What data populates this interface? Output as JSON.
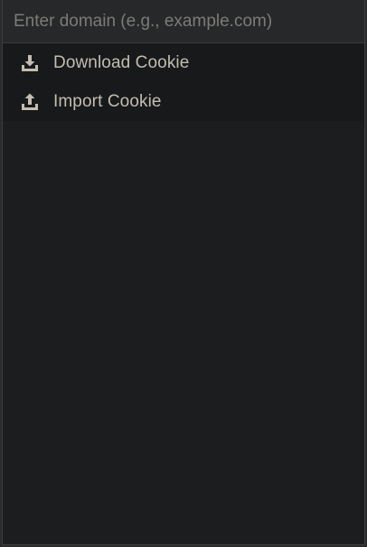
{
  "search": {
    "placeholder": "Enter domain (e.g., example.com)",
    "value": ""
  },
  "menu": {
    "items": [
      {
        "label": "Download Cookie",
        "icon": "download-icon"
      },
      {
        "label": "Import Cookie",
        "icon": "upload-icon"
      }
    ]
  },
  "colors": {
    "background": "#1b1d1e",
    "menu_background": "#17191a",
    "input_background": "#262829",
    "text": "#c3bdb2",
    "placeholder": "#7d7b77"
  }
}
